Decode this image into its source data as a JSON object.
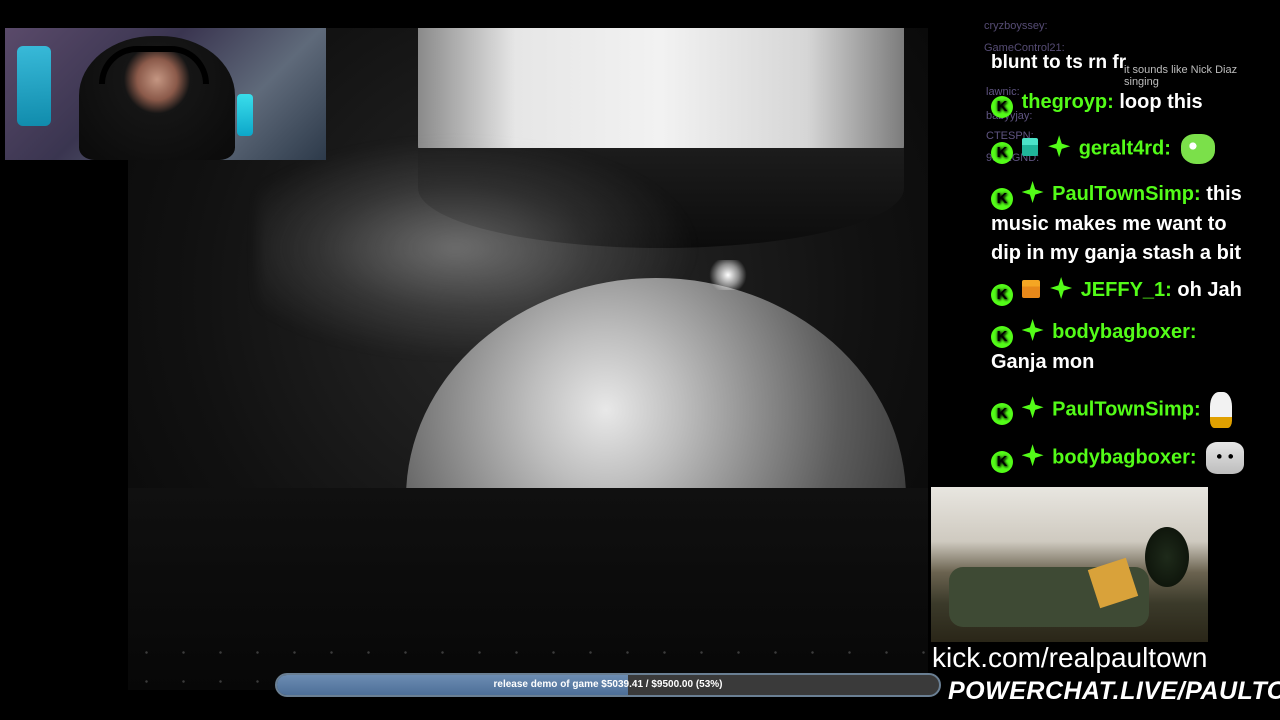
{
  "chat": {
    "ghost_top": "cryzboyssey:",
    "ghost_gc": "GameControl21:",
    "blunt": "blunt to ts rn fr",
    "nick_overlay": "it sounds like Nick Diaz singing",
    "ghost_lawnic": "lawnic:",
    "ghost_babyjay": "babyyjay:",
    "ghost_ctespn": "CTESPN:",
    "ghost_legnd": "95LEGND:",
    "messages": [
      {
        "user": "thegroyp:",
        "text": "loop this"
      },
      {
        "user": "geralt4rd:",
        "text": ""
      },
      {
        "user": "PaulTownSimp:",
        "text": "this music makes me want to dip in my ganja stash a bit"
      },
      {
        "user": "JEFFY_1:",
        "text": "oh Jah"
      },
      {
        "user": "bodybagboxer:",
        "text": "Ganja mon"
      },
      {
        "user": "PaulTownSimp:",
        "text": ""
      },
      {
        "user": "bodybagboxer:",
        "text": ""
      }
    ]
  },
  "progress": {
    "label": "release demo of game $5039.41 / $9500.00 (53%)",
    "percent": 53
  },
  "branding": {
    "kick_url": "kick.com/realpaultown",
    "powerchat": "POWERCHAT.LIVE/PAULTOWN"
  },
  "colors": {
    "kick_green": "#53fc18",
    "progress_fill": "#5b7ca6"
  }
}
